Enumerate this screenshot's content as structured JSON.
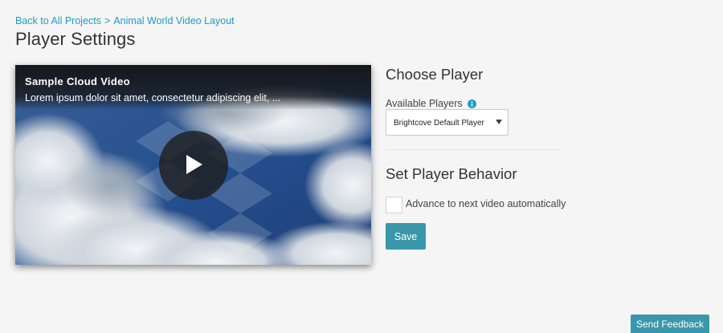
{
  "breadcrumb": {
    "back_link": "Back to All Projects",
    "separator": ">",
    "project_link": "Animal World Video Layout"
  },
  "page_title": "Player Settings",
  "video": {
    "title": "Sample Cloud Video",
    "description": "Lorem ipsum dolor sit amet, consectetur adipiscing elit, ..."
  },
  "choose_player": {
    "heading": "Choose Player",
    "available_label": "Available Players",
    "selected_player": "Brightcove Default Player"
  },
  "behavior": {
    "heading": "Set Player Behavior",
    "advance_label": "Advance to next video automatically",
    "advance_checked": false
  },
  "buttons": {
    "save": "Save",
    "feedback": "Send Feedback"
  },
  "colors": {
    "link": "#1e9cc4",
    "accent": "#3a97a9",
    "info_icon": "#1e9cc4"
  }
}
